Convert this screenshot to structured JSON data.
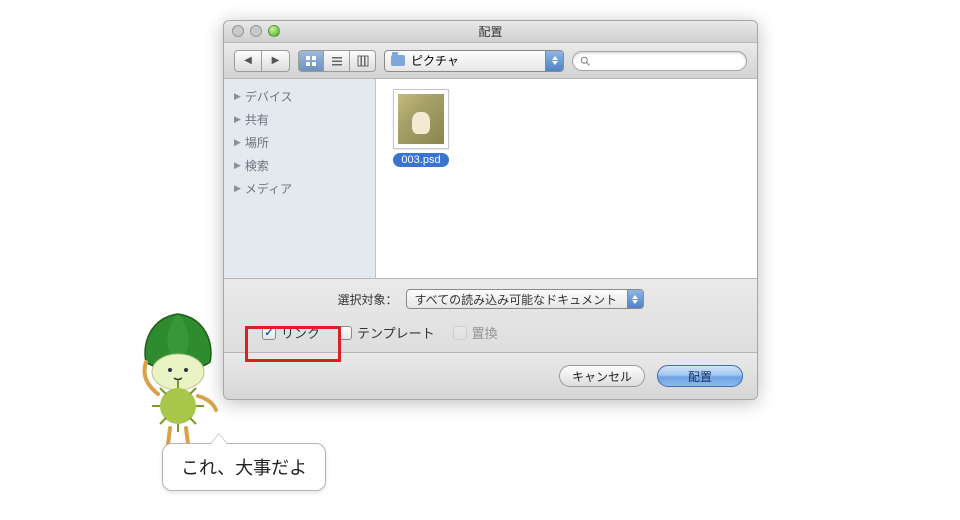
{
  "window": {
    "title": "配置"
  },
  "toolbar": {
    "path_label": "ピクチャ",
    "search_placeholder": ""
  },
  "sidebar": {
    "items": [
      {
        "label": "デバイス"
      },
      {
        "label": "共有"
      },
      {
        "label": "場所"
      },
      {
        "label": "検索"
      },
      {
        "label": "メディア"
      }
    ]
  },
  "files": {
    "selected": {
      "name": "003.psd"
    }
  },
  "options": {
    "filter_label": "選択対象：",
    "filter_value": "すべての読み込み可能なドキュメント",
    "link_label": "リンク",
    "template_label": "テンプレート",
    "replace_label": "置換"
  },
  "footer": {
    "cancel_label": "キャンセル",
    "confirm_label": "配置"
  },
  "annotation": {
    "speech_text": "これ、大事だよ"
  }
}
